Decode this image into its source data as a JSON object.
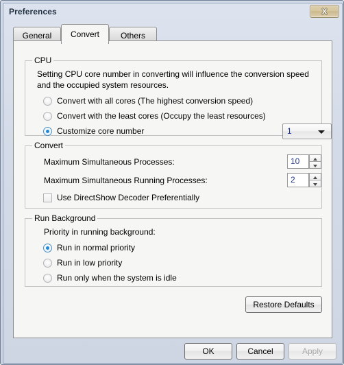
{
  "window": {
    "title": "Preferences",
    "close_label": "X",
    "close_icon": "close-icon"
  },
  "tabs": [
    {
      "label": "General",
      "active": false
    },
    {
      "label": "Convert",
      "active": true
    },
    {
      "label": "Others",
      "active": false
    }
  ],
  "cpu": {
    "group_title": "CPU",
    "description": "Setting CPU core number in converting will influence the conversion speed and the occupied system resources.",
    "options": [
      {
        "label": "Convert with all cores (The highest conversion speed)",
        "selected": false
      },
      {
        "label": "Convert with the least cores (Occupy the least resources)",
        "selected": false
      },
      {
        "label": "Customize core number",
        "selected": true
      }
    ],
    "core_combo": {
      "value": "1",
      "arrow_icon": "chevron-down-icon"
    }
  },
  "convert": {
    "group_title": "Convert",
    "max_simultaneous_processes": {
      "label": "Maximum Simultaneous Processes:",
      "value": "10"
    },
    "max_simultaneous_running_processes": {
      "label": "Maximum Simultaneous Running Processes:",
      "value": "2"
    },
    "directshow_checkbox": {
      "label": "Use DirectShow Decoder Preferentially",
      "checked": false
    }
  },
  "run_background": {
    "group_title": "Run Background",
    "priority_label": "Priority in running background:",
    "options": [
      {
        "label": "Run in normal priority",
        "selected": true
      },
      {
        "label": "Run in low priority",
        "selected": false
      },
      {
        "label": "Run only when the system is idle",
        "selected": false
      }
    ]
  },
  "actions": {
    "restore_defaults": "Restore Defaults",
    "ok": "OK",
    "cancel": "Cancel",
    "apply": "Apply",
    "apply_disabled": true
  },
  "colors": {
    "accent_radio": "#1e87d8",
    "title_text": "#203040",
    "panel_bg": "#f6f6f4",
    "frame": "#6f7f96",
    "field_text": "#21388f"
  }
}
